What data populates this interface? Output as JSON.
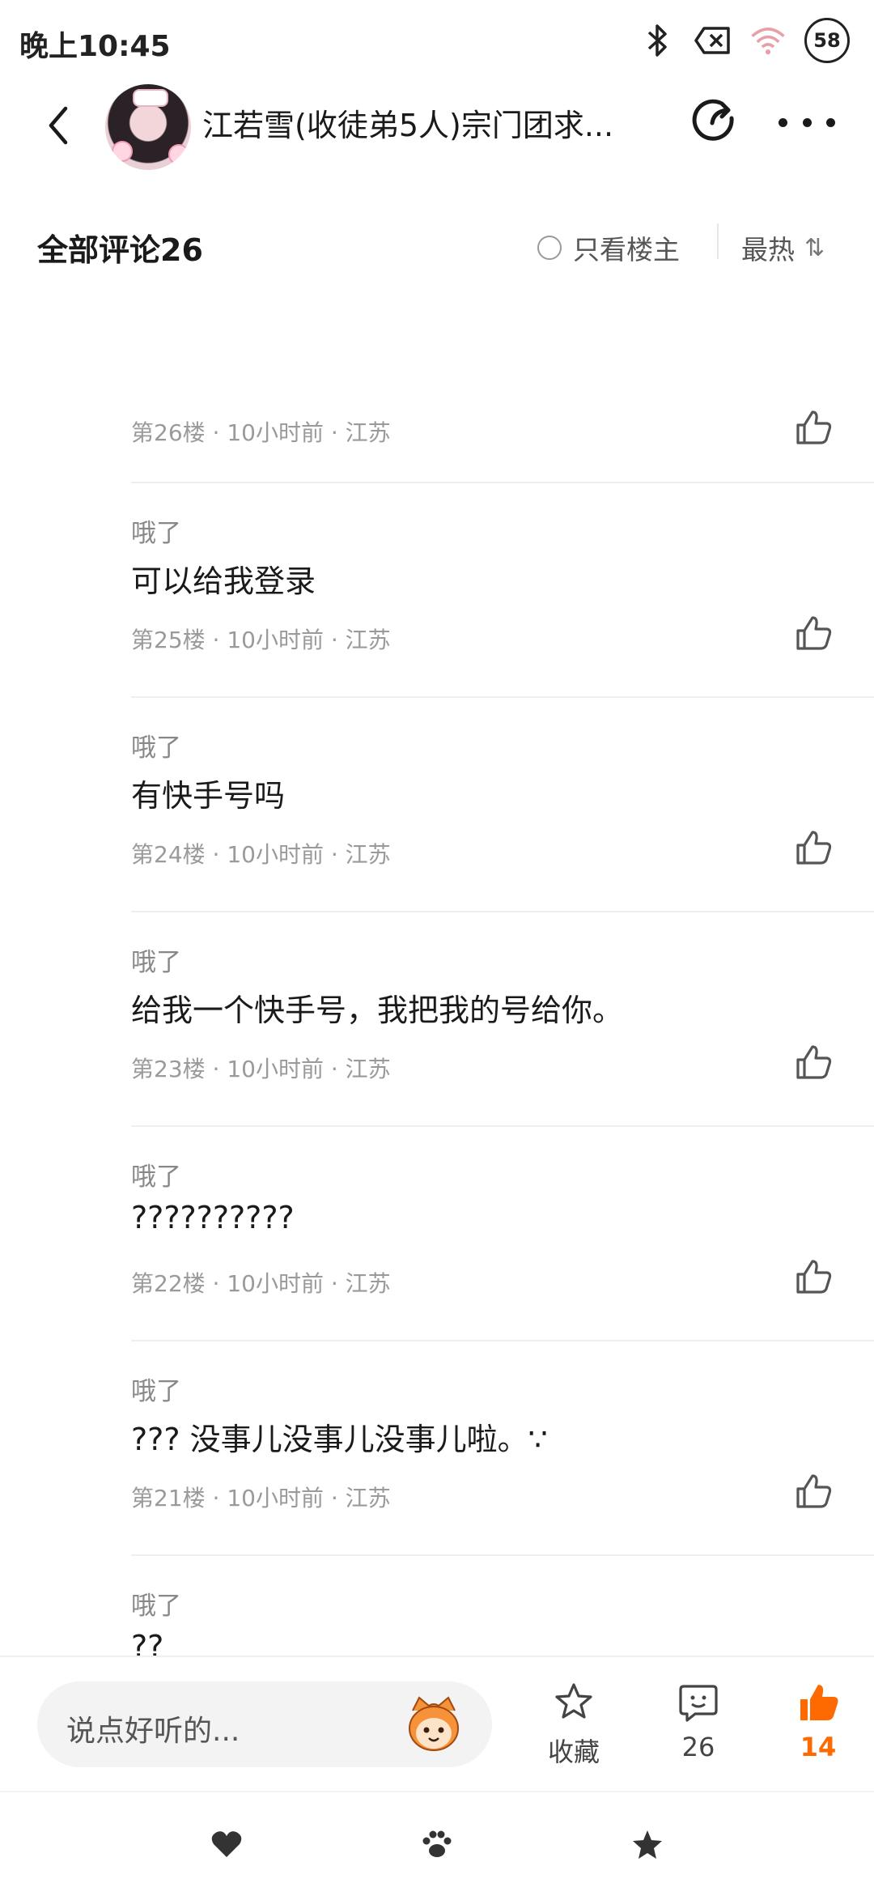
{
  "status": {
    "time": "晚上10:45",
    "battery": "58",
    "icons": [
      "bluetooth-icon",
      "data-off-icon",
      "wifi-icon"
    ]
  },
  "nav": {
    "title": "江若雪(收徒弟5人)宗门团求...",
    "back_icon": "chevron-left-icon",
    "share_icon": "share-icon",
    "more_icon": "more-dots-icon"
  },
  "comments_header": {
    "title": "全部评论26",
    "op_only_label": "只看楼主",
    "sort_label": "最热",
    "sort_icon": "⇅"
  },
  "first_meta": "第26楼 · 10小时前 · 江苏",
  "comments": [
    {
      "user": "哦了",
      "text": "可以给我登录",
      "meta": "第25楼 · 10小时前 · 江苏"
    },
    {
      "user": "哦了",
      "text": "有快手号吗",
      "meta": "第24楼 · 10小时前 · 江苏"
    },
    {
      "user": "哦了",
      "text": "给我一个快手号，我把我的号给你。",
      "meta": "第23楼 · 10小时前 · 江苏"
    },
    {
      "user": "哦了",
      "text": "??????????",
      "meta": "第22楼 · 10小时前 · 江苏"
    },
    {
      "user": "哦了",
      "text": "??? 没事儿没事儿没事儿啦。∵",
      "meta": "第21楼 · 10小时前 · 江苏"
    },
    {
      "user": "哦了",
      "text": "??",
      "meta": ""
    }
  ],
  "bottom_bar": {
    "input_placeholder": "说点好听的...",
    "fav_label": "收藏",
    "comment_count": "26",
    "like_count": "14",
    "accent_color": "#ff6a00"
  },
  "system_nav": [
    "heart-icon",
    "paw-icon",
    "star-icon"
  ]
}
